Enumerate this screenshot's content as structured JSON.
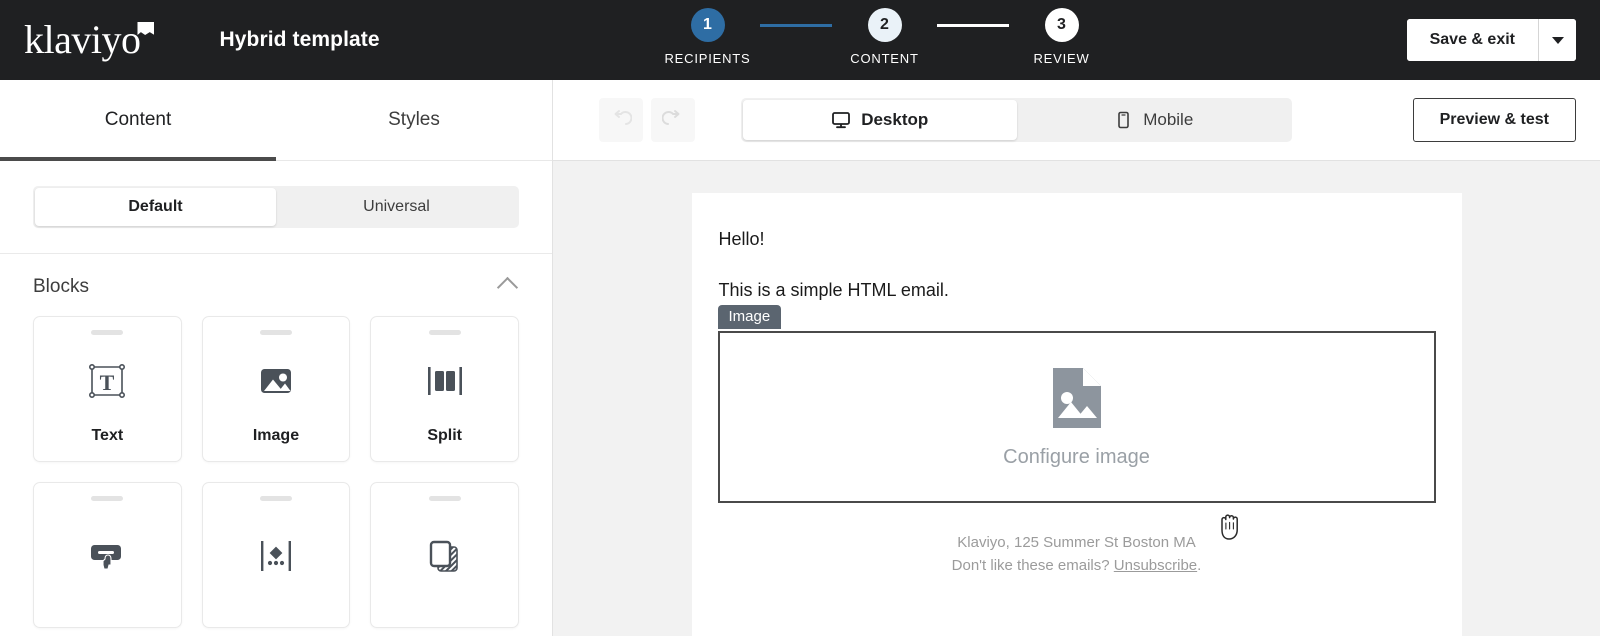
{
  "header": {
    "logo_text": "klaviyo",
    "logo_icon": "klaviyo-flag-mark",
    "template_title": "Hybrid template",
    "save_label": "Save & exit",
    "save_caret_icon": "chevron-down-icon",
    "steps": [
      {
        "number": "1",
        "label": "RECIPIENTS",
        "state": "done"
      },
      {
        "number": "2",
        "label": "CONTENT",
        "state": "current"
      },
      {
        "number": "3",
        "label": "REVIEW",
        "state": "upcoming"
      }
    ],
    "connector_colors": [
      "#2e6da4",
      "#ffffff"
    ]
  },
  "sidebar": {
    "tabs": [
      {
        "label": "Content",
        "active": true
      },
      {
        "label": "Styles",
        "active": false
      }
    ],
    "segmented": [
      {
        "label": "Default",
        "active": true
      },
      {
        "label": "Universal",
        "active": false
      }
    ],
    "blocks_section": {
      "title": "Blocks",
      "collapse_icon": "chevron-up-icon"
    },
    "blocks": [
      {
        "label": "Text",
        "icon": "text-block-icon"
      },
      {
        "label": "Image",
        "icon": "image-block-icon"
      },
      {
        "label": "Split",
        "icon": "split-block-icon"
      },
      {
        "label": "",
        "icon": "button-block-icon"
      },
      {
        "label": "",
        "icon": "divider-block-icon"
      },
      {
        "label": "",
        "icon": "card-block-icon"
      }
    ]
  },
  "toolbar": {
    "undo_icon": "undo-icon",
    "redo_icon": "redo-icon",
    "devices": [
      {
        "label": "Desktop",
        "icon": "desktop-icon",
        "active": true
      },
      {
        "label": "Mobile",
        "icon": "mobile-icon",
        "active": false
      }
    ],
    "preview_label": "Preview & test"
  },
  "email": {
    "line1": "Hello!",
    "line2": "This is a simple HTML email.",
    "selected_block_badge": "Image",
    "placeholder_label": "Configure image",
    "placeholder_icon": "image-file-icon",
    "footer_address": "Klaviyo, 125 Summer St Boston MA",
    "footer_prompt": "Don't like these emails?",
    "footer_link": "Unsubscribe",
    "footer_period": "."
  },
  "cursor": {
    "type": "grab-hand-cursor"
  },
  "colors": {
    "topbar_bg": "#1f2022",
    "accent_blue": "#2e6da4",
    "canvas_bg": "#f2f2f2",
    "badge_bg": "#5b6570",
    "selection_border": "#4a4a4a",
    "muted_text": "#9aa0a6"
  }
}
